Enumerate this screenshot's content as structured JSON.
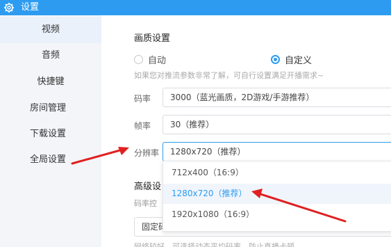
{
  "window": {
    "title": "设置",
    "icon": "gear-icon"
  },
  "sidebar": {
    "items": [
      {
        "label": "视频",
        "active": true
      },
      {
        "label": "音频"
      },
      {
        "label": "快捷键"
      },
      {
        "label": "房间管理"
      },
      {
        "label": "下载设置"
      },
      {
        "label": "全局设置"
      }
    ]
  },
  "video": {
    "section_title": "画质设置",
    "mode_options": [
      {
        "label": "自动",
        "checked": false
      },
      {
        "label": "自定义",
        "checked": true
      }
    ],
    "hint": "如果您对推流参数非常了解，可自行设置满足开播需求~",
    "bitrate": {
      "label": "码率",
      "value": "3000（蓝光画质，2D游戏/手游推荐）"
    },
    "fps": {
      "label": "帧率",
      "value": "30（推荐）"
    },
    "resolution": {
      "label": "分辨率",
      "value": "1280x720（推荐）",
      "options": [
        "712x400（16:9）",
        "1280x720（推荐）",
        "1920x1080（16:9）"
      ],
      "selected_index": 1
    }
  },
  "advanced": {
    "title": "高级设",
    "bitrate_control_label": "码率控",
    "bitrate_control_value": "固定码率",
    "bottom_hint": "网络较好，可选择动态平均码率，防止直播卡顿"
  },
  "colors": {
    "accent": "#2d9cf0",
    "annotation_arrow": "#e02020"
  }
}
